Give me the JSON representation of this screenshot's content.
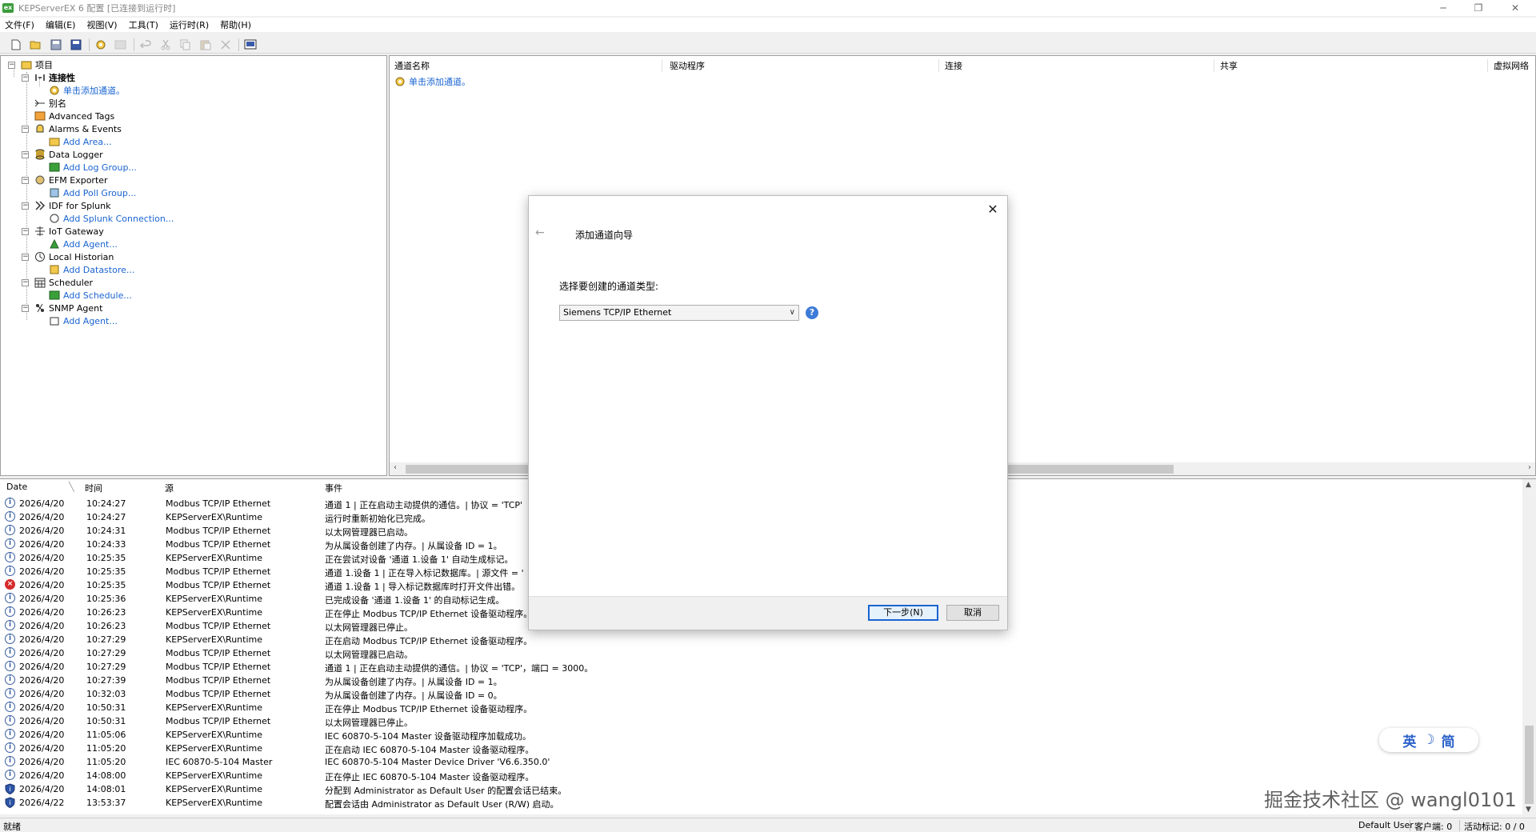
{
  "window": {
    "title": "KEPServerEX 6 配置 [已连接到运行时]",
    "app_icon_text": "ex",
    "minimize": "─",
    "restore": "❐",
    "close": "✕"
  },
  "menu": [
    "文件(F)",
    "编辑(E)",
    "视图(V)",
    "工具(T)",
    "运行时(R)",
    "帮助(H)"
  ],
  "tree": {
    "root": "项目",
    "connectivity": "连接性",
    "add_channel": "单击添加通道。",
    "alias": "别名",
    "advanced_tags": "Advanced Tags",
    "alarms_events": "Alarms & Events",
    "add_area": "Add Area...",
    "data_logger": "Data Logger",
    "add_log_group": "Add Log Group...",
    "efm_exporter": "EFM Exporter",
    "add_poll_group": "Add Poll Group...",
    "idf_splunk": "IDF for Splunk",
    "add_splunk": "Add Splunk Connection...",
    "iot_gateway": "IoT Gateway",
    "add_agent": "Add Agent...",
    "local_historian": "Local Historian",
    "add_datastore": "Add Datastore...",
    "scheduler": "Scheduler",
    "add_schedule": "Add Schedule...",
    "snmp_agent": "SNMP Agent",
    "add_agent2": "Add Agent..."
  },
  "channel_list": {
    "columns": [
      "通道名称",
      "驱动程序",
      "连接",
      "共享",
      "虚拟网络"
    ],
    "add_channel_link": "单击添加通道。"
  },
  "log": {
    "columns": [
      "Date",
      "时间",
      "源",
      "事件"
    ],
    "rows": [
      {
        "type": "info",
        "date": "2026/4/20",
        "time": "10:24:27",
        "source": "Modbus TCP/IP Ethernet",
        "event": "通道 1 | 正在启动主动提供的通信。| 协议 = 'TCP'"
      },
      {
        "type": "info",
        "date": "2026/4/20",
        "time": "10:24:27",
        "source": "KEPServerEX\\Runtime",
        "event": "运行时重新初始化已完成。"
      },
      {
        "type": "info",
        "date": "2026/4/20",
        "time": "10:24:31",
        "source": "Modbus TCP/IP Ethernet",
        "event": "以太网管理器已启动。"
      },
      {
        "type": "info",
        "date": "2026/4/20",
        "time": "10:24:33",
        "source": "Modbus TCP/IP Ethernet",
        "event": "为从属设备创建了内存。| 从属设备 ID = 1。"
      },
      {
        "type": "info",
        "date": "2026/4/20",
        "time": "10:25:35",
        "source": "KEPServerEX\\Runtime",
        "event": "正在尝试对设备 '通道 1.设备 1' 自动生成标记。"
      },
      {
        "type": "info",
        "date": "2026/4/20",
        "time": "10:25:35",
        "source": "Modbus TCP/IP Ethernet",
        "event": "通道 1.设备 1 | 正在导入标记数据库。| 源文件 = '"
      },
      {
        "type": "error",
        "date": "2026/4/20",
        "time": "10:25:35",
        "source": "Modbus TCP/IP Ethernet",
        "event": "通道 1.设备 1 | 导入标记数据库时打开文件出错。"
      },
      {
        "type": "info",
        "date": "2026/4/20",
        "time": "10:25:36",
        "source": "KEPServerEX\\Runtime",
        "event": "已完成设备 '通道 1.设备 1' 的自动标记生成。"
      },
      {
        "type": "info",
        "date": "2026/4/20",
        "time": "10:26:23",
        "source": "KEPServerEX\\Runtime",
        "event": "正在停止 Modbus TCP/IP Ethernet 设备驱动程序。"
      },
      {
        "type": "info",
        "date": "2026/4/20",
        "time": "10:26:23",
        "source": "Modbus TCP/IP Ethernet",
        "event": "以太网管理器已停止。"
      },
      {
        "type": "info",
        "date": "2026/4/20",
        "time": "10:27:29",
        "source": "KEPServerEX\\Runtime",
        "event": "正在启动 Modbus TCP/IP Ethernet 设备驱动程序。"
      },
      {
        "type": "info",
        "date": "2026/4/20",
        "time": "10:27:29",
        "source": "Modbus TCP/IP Ethernet",
        "event": "以太网管理器已启动。"
      },
      {
        "type": "info",
        "date": "2026/4/20",
        "time": "10:27:29",
        "source": "Modbus TCP/IP Ethernet",
        "event": "通道 1 | 正在启动主动提供的通信。| 协议 = 'TCP'，端口 = 3000。"
      },
      {
        "type": "info",
        "date": "2026/4/20",
        "time": "10:27:39",
        "source": "Modbus TCP/IP Ethernet",
        "event": "为从属设备创建了内存。| 从属设备 ID = 1。"
      },
      {
        "type": "info",
        "date": "2026/4/20",
        "time": "10:32:03",
        "source": "Modbus TCP/IP Ethernet",
        "event": "为从属设备创建了内存。| 从属设备 ID = 0。"
      },
      {
        "type": "info",
        "date": "2026/4/20",
        "time": "10:50:31",
        "source": "KEPServerEX\\Runtime",
        "event": "正在停止 Modbus TCP/IP Ethernet 设备驱动程序。"
      },
      {
        "type": "info",
        "date": "2026/4/20",
        "time": "10:50:31",
        "source": "Modbus TCP/IP Ethernet",
        "event": "以太网管理器已停止。"
      },
      {
        "type": "info",
        "date": "2026/4/20",
        "time": "11:05:06",
        "source": "KEPServerEX\\Runtime",
        "event": "IEC 60870-5-104 Master 设备驱动程序加载成功。"
      },
      {
        "type": "info",
        "date": "2026/4/20",
        "time": "11:05:20",
        "source": "KEPServerEX\\Runtime",
        "event": "正在启动 IEC 60870-5-104 Master 设备驱动程序。"
      },
      {
        "type": "info",
        "date": "2026/4/20",
        "time": "11:05:20",
        "source": "IEC 60870-5-104 Master",
        "event": "IEC 60870-5-104 Master Device Driver 'V6.6.350.0'"
      },
      {
        "type": "info",
        "date": "2026/4/20",
        "time": "14:08:00",
        "source": "KEPServerEX\\Runtime",
        "event": "正在停止 IEC 60870-5-104 Master 设备驱动程序。"
      },
      {
        "type": "security",
        "date": "2026/4/20",
        "time": "14:08:01",
        "source": "KEPServerEX\\Runtime",
        "event": "分配到 Administrator as Default User 的配置会话已结束。"
      },
      {
        "type": "security",
        "date": "2026/4/22",
        "time": "13:53:37",
        "source": "KEPServerEX\\Runtime",
        "event": "配置会话由 Administrator as Default User (R/W) 启动。"
      }
    ]
  },
  "status": {
    "left": "就绪",
    "user": "Default User",
    "clients": "客户端: 0",
    "tags": "活动标记: 0 / 0"
  },
  "dialog": {
    "title": "添加通道向导",
    "prompt": "选择要创建的通道类型:",
    "selected_driver": "Siemens TCP/IP Ethernet",
    "help": "?",
    "close": "✕",
    "back": "←",
    "next_button": "下一步(N)",
    "cancel_button": "取消"
  },
  "ime": {
    "lang": "英",
    "moon": "☽",
    "mode": "简"
  },
  "watermark": "掘金技术社区 @ wangl0101"
}
